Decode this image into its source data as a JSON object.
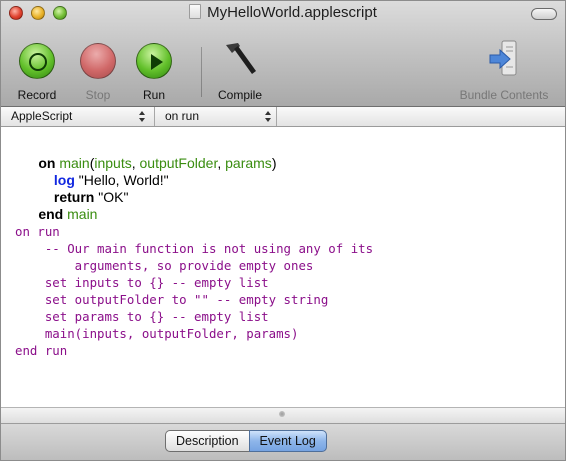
{
  "window": {
    "title": "MyHelloWorld.applescript"
  },
  "toolbar": {
    "record_label": "Record",
    "stop_label": "Stop",
    "run_label": "Run",
    "compile_label": "Compile",
    "bundle_label": "Bundle Contents"
  },
  "navbar": {
    "language": "AppleScript",
    "handler": "on run"
  },
  "code": {
    "l1_on": "on",
    "l1_main": " main",
    "l1_paren_open": "(",
    "l1_inputs": "inputs",
    "l1_comma1": ", ",
    "l1_outputFolder": "outputFolder",
    "l1_comma2": ", ",
    "l1_params": "params",
    "l1_paren_close": ")",
    "l2_indent": "    ",
    "l2_log": "log",
    "l2_rest": " \"Hello, World!\"",
    "l3_indent": "    ",
    "l3_return": "return",
    "l3_rest": " \"OK\"",
    "l4_end": "end",
    "l4_main": " main",
    "raw_lines": [
      "on run",
      "    -- Our main function is not using any of its",
      "        arguments, so provide empty ones",
      "    set inputs to {} -- empty list",
      "    set outputFolder to \"\" -- empty string",
      "    set params to {} -- empty list",
      "    main(inputs, outputFolder, params)",
      "end run"
    ]
  },
  "bottom": {
    "description_tab": "Description",
    "event_log_tab": "Event Log"
  }
}
